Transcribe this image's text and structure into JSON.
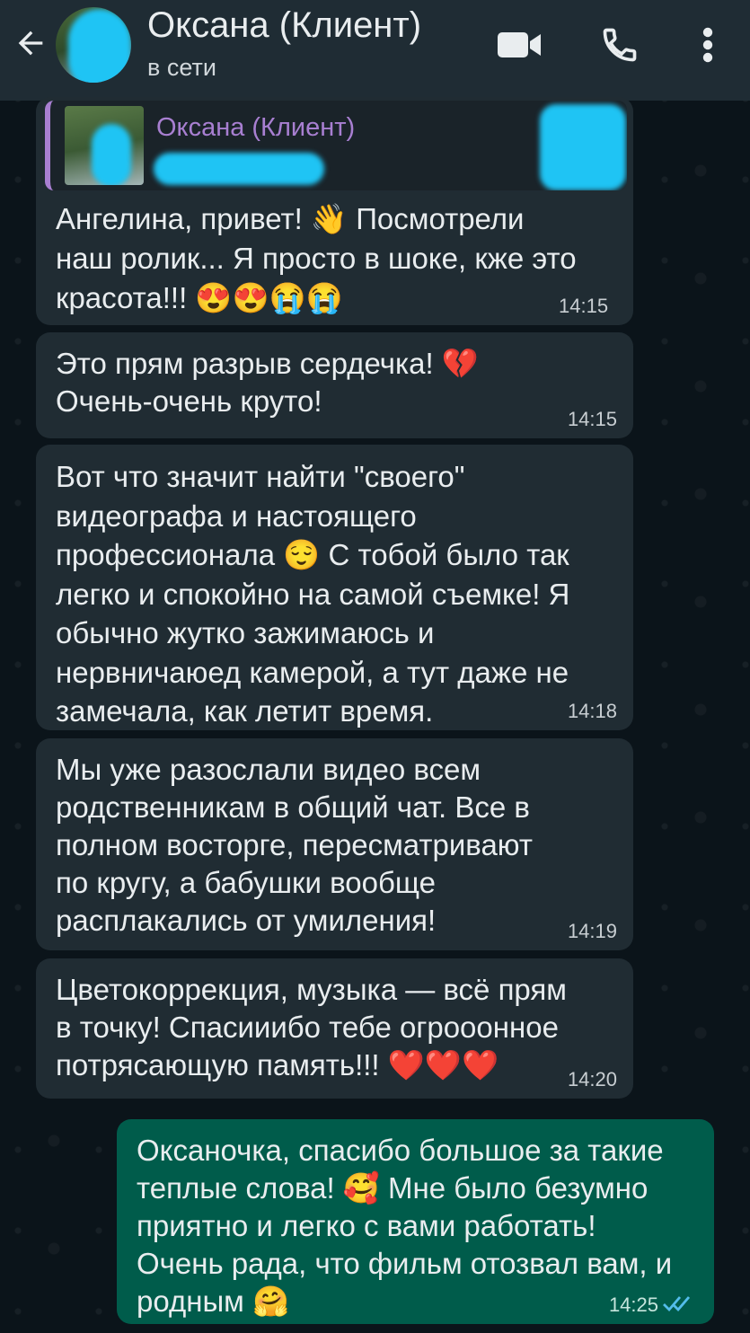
{
  "header": {
    "back_icon": "arrow-left-icon",
    "contact_name": "Оксана (Клиент)",
    "status": "в сети",
    "icons": [
      "video-call-icon",
      "phone-call-icon",
      "more-vert-icon"
    ]
  },
  "quote": {
    "author": "Оксана (Клиент)"
  },
  "messages": [
    {
      "direction": "incoming",
      "text": "Ангелина, привет! 👋 Посмотрели\nнаш ролик... Я просто в шоке, кже это\nкрасота!!! 😍😍😭😭",
      "time": "14:15"
    },
    {
      "direction": "incoming",
      "text": "Это прям разрыв сердечка! 💔\nОчень-очень круто!",
      "time": "14:15"
    },
    {
      "direction": "incoming",
      "text": "Вот что значит найти \"своего\"\nвидеографа и настоящего\nпрофессионала 😌 С тобой было так\nлегко и спокойно на самой съемке! Я\nобычно жутко зажимаюсь и\nнервничаюед камерой, а тут даже не\nзамечала, как летит время.",
      "time": "14:18"
    },
    {
      "direction": "incoming",
      "text": "Мы уже разослали видео всем\nродственникам в общий чат. Все в\nполном восторге, пересматривают\nпо кругу, а бабушки вообще\nрасплакались от умиления!",
      "time": "14:19"
    },
    {
      "direction": "incoming",
      "text": "Цветокоррекция, музыка — всё прям\nв точку! Спасииибо тебе огрооонное\nпотрясающую память!!! ❤️❤️❤️",
      "time": "14:20"
    },
    {
      "direction": "outgoing",
      "text": "Оксаночка, спасибо большое за такие\nтеплые слова! 🥰 Мне было безумно\nприятно и легко с вами работать!\nОчень рада, что фильм отозвал вам, и\nродным 🤗",
      "time": "14:25",
      "status_icon": "double-check-read-icon"
    }
  ],
  "colors": {
    "header_bg": "#1f2c34",
    "incoming_bubble": "#202c33",
    "outgoing_bubble": "#005c4b",
    "quote_accent": "#a87fd1",
    "read_tick": "#53bdeb"
  }
}
